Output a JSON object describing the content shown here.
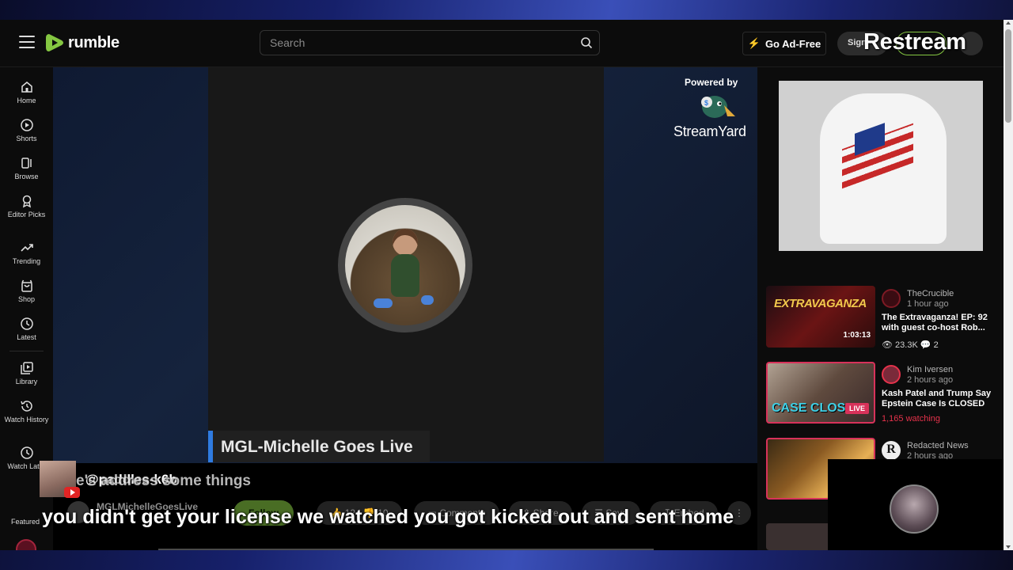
{
  "header": {
    "brand": "rumble",
    "search_placeholder": "Search",
    "ad_free_label": "Go Ad-Free",
    "sign_in_label": "Sign",
    "overlay_brand": "Restream"
  },
  "sidebar": {
    "items": [
      {
        "label": "Home",
        "icon": "home-icon"
      },
      {
        "label": "Shorts",
        "icon": "shorts-icon"
      },
      {
        "label": "Browse",
        "icon": "browse-icon"
      },
      {
        "label": "Editor Picks",
        "icon": "editor-picks-icon"
      },
      {
        "label": "Trending",
        "icon": "trending-icon"
      },
      {
        "label": "Shop",
        "icon": "shop-icon"
      },
      {
        "label": "Latest",
        "icon": "clock-icon"
      },
      {
        "label": "Library",
        "icon": "library-icon"
      },
      {
        "label": "Watch History",
        "icon": "history-icon"
      },
      {
        "label": "Watch Later",
        "icon": "clock-icon"
      }
    ],
    "featured_label": "Featured"
  },
  "player": {
    "stream_title": "MGL-Michelle Goes Live",
    "powered_by": "Powered by",
    "stream_service": "StreamYard"
  },
  "below": {
    "channel_name": "MGLMichelleGoesLive",
    "follow_label": "Follow",
    "likes": "12",
    "dislikes": "10",
    "comments_label": "Comments",
    "share_label": "Share",
    "save_label": "Save",
    "embed_label": "Embed"
  },
  "overlay": {
    "comment_user": "@paddles-k6b",
    "comment_text": "e's address some things",
    "caption": "you didn't get your license we watched you got kicked out and sent home"
  },
  "related": [
    {
      "channel": "TheCrucible",
      "time": "1 hour ago",
      "title": "The Extravaganza! EP: 92 with guest co-host Rob...",
      "thumb_title": "EXTRAVAGANZA",
      "duration": "1:03:13",
      "views": "23.3K",
      "comments": "2"
    },
    {
      "channel": "Kim Iversen",
      "time": "2 hours ago",
      "title": "Kash Patel and Trump Say Epstein Case Is CLOSED",
      "thumb_title": "CASE CLOSED",
      "live": "LIVE",
      "watching": "1,165 watching"
    },
    {
      "channel": "Redacted News",
      "time": "2 hours ago"
    }
  ],
  "colors": {
    "rumble_green": "#85c742",
    "live_red": "#e6324b",
    "streamyard_blue": "#2f7be0"
  }
}
